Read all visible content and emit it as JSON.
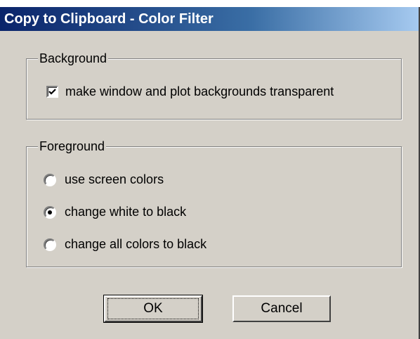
{
  "window": {
    "title": "Copy to Clipboard - Color Filter"
  },
  "background_group": {
    "label": "Background",
    "checkbox": {
      "label": "make window and plot backgrounds transparent",
      "checked": true
    }
  },
  "foreground_group": {
    "label": "Foreground",
    "options": [
      {
        "label": "use screen colors",
        "selected": false
      },
      {
        "label": "change white to black",
        "selected": true
      },
      {
        "label": "change all colors to black",
        "selected": false
      }
    ]
  },
  "buttons": {
    "ok": "OK",
    "cancel": "Cancel"
  }
}
